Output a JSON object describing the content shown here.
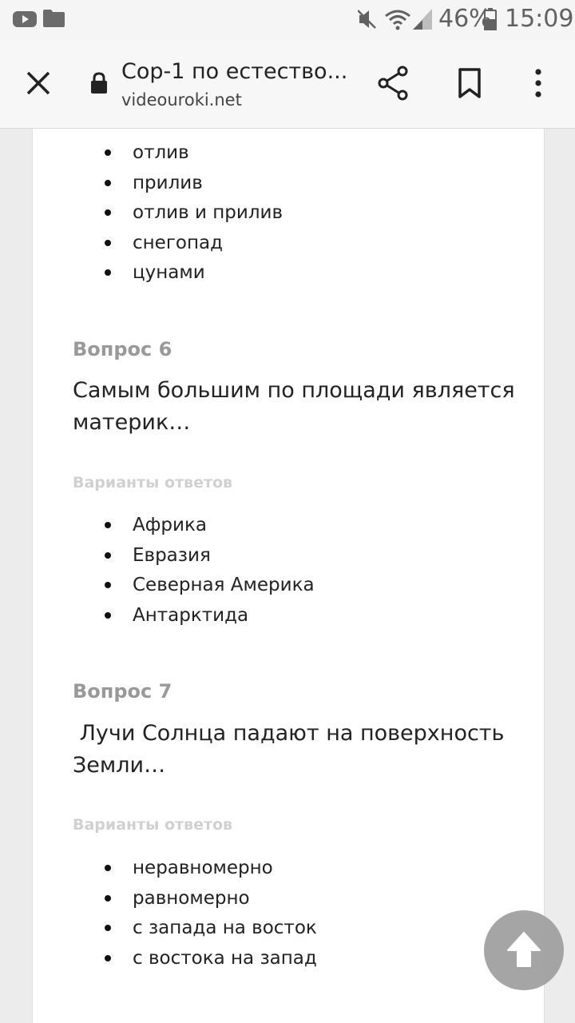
{
  "status_bar": {
    "battery_percent": "46%",
    "time": "15:09",
    "icons": [
      "youtube-icon",
      "folder-icon",
      "mute-icon",
      "wifi-icon",
      "signal-icon",
      "battery-icon"
    ]
  },
  "toolbar": {
    "title": "Сор-1 по естество...",
    "url": "videouroki.net",
    "icons": [
      "close-icon",
      "lock-icon",
      "share-icon",
      "bookmark-icon",
      "more-vert-icon"
    ]
  },
  "content": {
    "prev_answers": [
      "отлив",
      "прилив",
      "отлив и прилив",
      "снегопад",
      "цунами"
    ],
    "questions": [
      {
        "title": "Вопрос 6",
        "text": "Самым большим по площади является материк…",
        "variants_label": "Варианты ответов",
        "answers": [
          "Африка",
          "Евразия",
          "Северная Америка",
          "Антарктида"
        ]
      },
      {
        "title": "Вопрос 7",
        "text": " Лучи Солнца падают на поверхность Земли…",
        "variants_label": "Варианты ответов",
        "answers": [
          "неравномерно",
          "равномерно",
          "с запада на восток",
          "с востока на запад"
        ]
      }
    ]
  },
  "fab": {
    "icon": "arrow-up-icon"
  },
  "colors": {
    "status_bar_bg": "#f5f5f5",
    "toolbar_bg": "#f7f7f7",
    "page_bg": "#ececec",
    "card_bg": "#ffffff",
    "question_title": "#999999",
    "variants_label": "#d0d0d0",
    "fab_bg": "#9e9e9e"
  }
}
